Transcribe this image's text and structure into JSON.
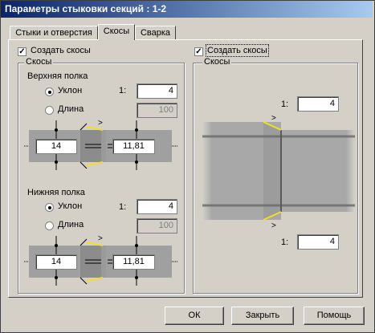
{
  "window": {
    "title": "Параметры стыковки секций : 1-2"
  },
  "tabs": [
    {
      "label": "Стыки и отверстия"
    },
    {
      "label": "Скосы"
    },
    {
      "label": "Сварка"
    }
  ],
  "left": {
    "create_checkbox": {
      "label": "Создать скосы",
      "checked": true
    },
    "group_title": "Скосы",
    "top_flange": {
      "title": "Верхняя полка",
      "slope_label": "Уклон",
      "length_label": "Длина",
      "ratio_prefix": "1:",
      "slope_value": "4",
      "length_value": "100",
      "selected": "slope",
      "dim_left": "14",
      "dim_right": "11,81"
    },
    "bottom_flange": {
      "title": "Нижняя полка",
      "slope_label": "Уклон",
      "length_label": "Длина",
      "ratio_prefix": "1:",
      "slope_value": "4",
      "length_value": "100",
      "selected": "slope",
      "dim_left": "14",
      "dim_right": "11,81"
    }
  },
  "right": {
    "create_checkbox": {
      "label": "Создать скосы",
      "checked": true
    },
    "group_title": "Скосы",
    "ratio_prefix": "1:",
    "top_value": "4",
    "bottom_value": "4"
  },
  "buttons": {
    "ok": "ОК",
    "close": "Закрыть",
    "help": "Помощь"
  },
  "colors": {
    "title_start": "#0a246a",
    "title_end": "#a6caf0",
    "bevel_yellow": "#f0e020",
    "face": "#d4d0c8"
  }
}
